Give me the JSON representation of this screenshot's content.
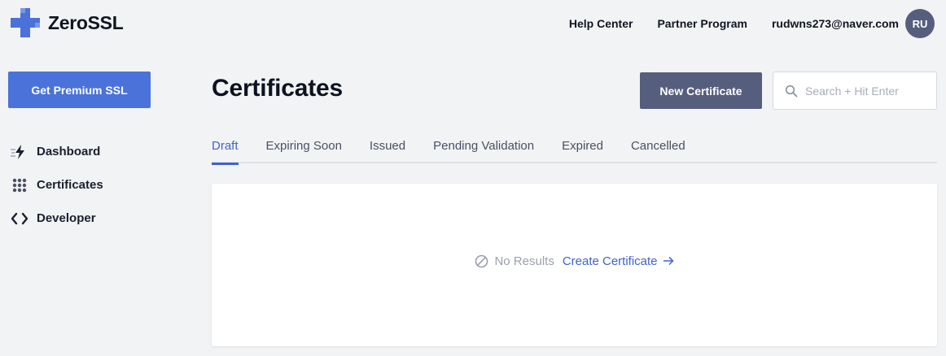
{
  "app": {
    "logo_text": "ZeroSSL",
    "brand_color": "#4a72d9"
  },
  "top_nav": {
    "help_center": "Help Center",
    "partner_program": "Partner Program",
    "email": "rudwns273@naver.com",
    "avatar_initials": "RU"
  },
  "sidebar": {
    "premium_button": "Get Premium SSL",
    "items": [
      {
        "label": "Dashboard",
        "icon": "lightning-icon"
      },
      {
        "label": "Certificates",
        "icon": "grid-dots-icon"
      },
      {
        "label": "Developer",
        "icon": "code-brackets-icon"
      }
    ]
  },
  "main": {
    "title": "Certificates",
    "new_certificate_button": "New Certificate",
    "search": {
      "placeholder": "Search + Hit Enter",
      "value": ""
    },
    "tabs": [
      {
        "label": "Draft",
        "active": true
      },
      {
        "label": "Expiring Soon",
        "active": false
      },
      {
        "label": "Issued",
        "active": false
      },
      {
        "label": "Pending Validation",
        "active": false
      },
      {
        "label": "Expired",
        "active": false
      },
      {
        "label": "Cancelled",
        "active": false
      }
    ],
    "empty_state": {
      "message": "No Results",
      "link_label": "Create Certificate",
      "icon": "ban-icon"
    }
  },
  "colors": {
    "accent": "#3f63c9",
    "button_dark": "#565e7e",
    "background": "#f2f3f5"
  }
}
